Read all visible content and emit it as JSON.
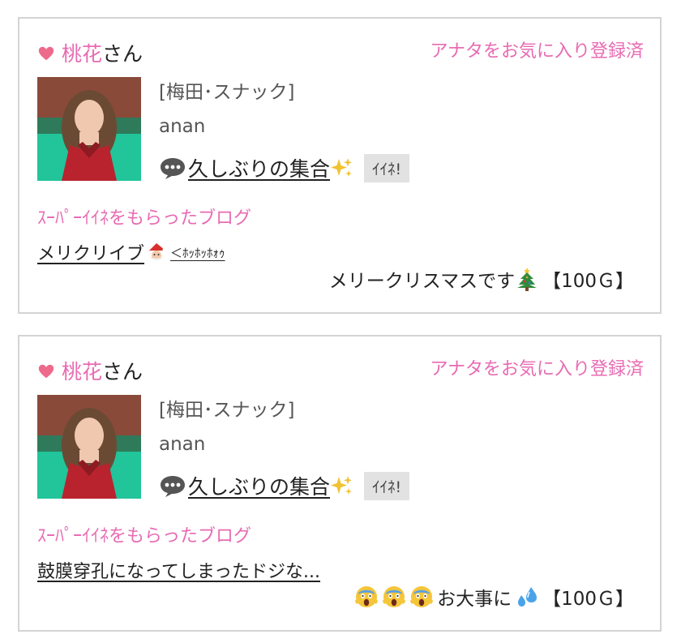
{
  "colors": {
    "accent_pink": "#e86bb3",
    "border": "#d4d4d4",
    "button_bg": "#e2e2e2"
  },
  "cards": [
    {
      "heart_icon": "heart-icon",
      "name": "桃花",
      "name_suffix": "さん",
      "favorite_status": "アナタをお気に入り登録済",
      "shop": "[梅田･スナック]",
      "username": "anan",
      "blog_title": "久しぶりの集合",
      "like_label": "ｲｲﾈ!",
      "super_like_label": "ｽｰﾊﾟｰｲｲﾈをもらったブログ",
      "post_title": "メリクリイブ",
      "post_title_tail": "＜ﾎｯﾎｯﾎｫｩ",
      "comment": "メリークリスマスです",
      "points": "【100Ｇ】"
    },
    {
      "heart_icon": "heart-icon",
      "name": "桃花",
      "name_suffix": "さん",
      "favorite_status": "アナタをお気に入り登録済",
      "shop": "[梅田･スナック]",
      "username": "anan",
      "blog_title": "久しぶりの集合",
      "like_label": "ｲｲﾈ!",
      "super_like_label": "ｽｰﾊﾟｰｲｲﾈをもらったブログ",
      "post_title": "鼓膜穿孔になってしまったドジな...",
      "comment": "お大事に",
      "points": "【100Ｇ】"
    }
  ]
}
